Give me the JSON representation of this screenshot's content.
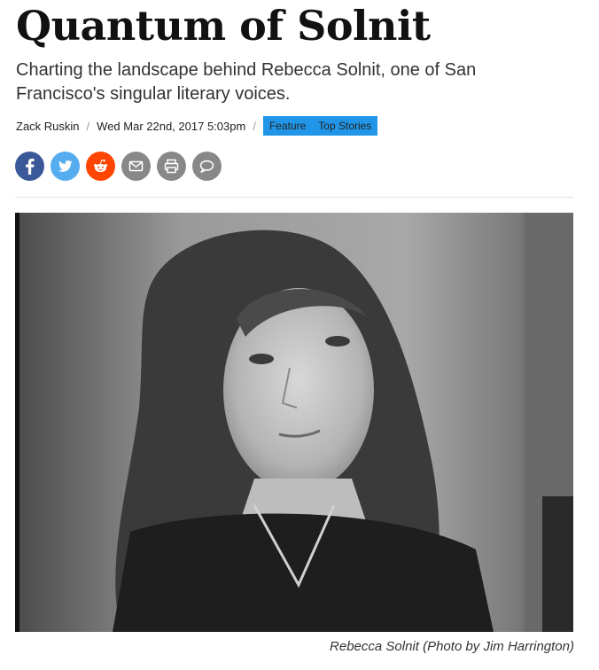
{
  "article": {
    "title": "Quantum of Solnit",
    "subtitle": "Charting the landscape behind Rebecca Solnit, one of San Francisco's singular literary voices.",
    "author": "Zack Ruskin",
    "separator": "/",
    "date": "Wed Mar 22nd, 2017 5:03pm",
    "tags": [
      "Feature",
      "Top Stories"
    ],
    "photo_caption": "Rebecca Solnit (Photo by Jim Harrington)"
  },
  "share": {
    "buttons": [
      {
        "icon": "facebook-icon",
        "color": "#3b5998"
      },
      {
        "icon": "twitter-icon",
        "color": "#55acee"
      },
      {
        "icon": "reddit-icon",
        "color": "#ff4500"
      },
      {
        "icon": "email-icon",
        "color": "#888888"
      },
      {
        "icon": "print-icon",
        "color": "#888888"
      },
      {
        "icon": "comment-icon",
        "color": "#888888"
      }
    ]
  },
  "colors": {
    "tag_background": "#2196e8",
    "title_text": "#111111"
  }
}
